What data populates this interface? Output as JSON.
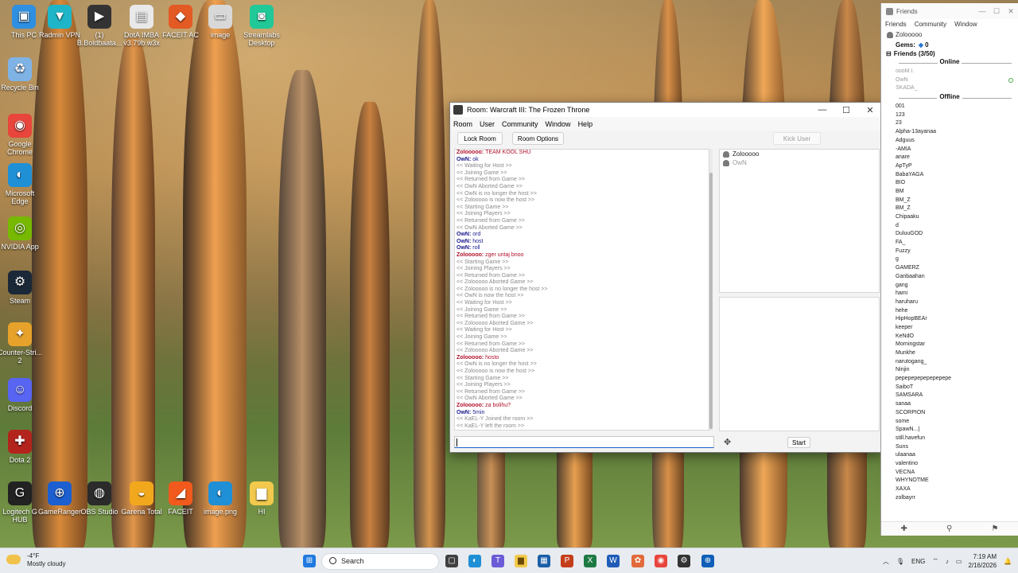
{
  "desktop": {
    "icons": [
      {
        "label": "This PC",
        "glyph": "▣",
        "color": "#2f8fe0"
      },
      {
        "label": "Radmin VPN",
        "glyph": "▼",
        "color": "#1fb5c8"
      },
      {
        "label": "(1) B.Boldbaata...",
        "glyph": "▶",
        "color": "#333333"
      },
      {
        "label": "DotA IMBA v3.79b.w3x",
        "glyph": "▤",
        "color": "#e9e9e9"
      },
      {
        "label": "FACEIT AC",
        "glyph": "◆",
        "color": "#e35a24"
      },
      {
        "label": "image",
        "glyph": "▭",
        "color": "#d8d8d8"
      },
      {
        "label": "Streamlabs Desktop",
        "glyph": "◙",
        "color": "#20c997"
      },
      {
        "label": "Recycle Bin",
        "glyph": "♻",
        "color": "#7fb3e6"
      },
      {
        "label": "Google Chrome",
        "glyph": "◉",
        "color": "#e8453c"
      },
      {
        "label": "Microsoft Edge",
        "glyph": "◐",
        "color": "#1f8fd6"
      },
      {
        "label": "NVIDIA App",
        "glyph": "◎",
        "color": "#76b900"
      },
      {
        "label": "Steam",
        "glyph": "⚙",
        "color": "#1b2838"
      },
      {
        "label": "Counter-Stri... 2",
        "glyph": "✦",
        "color": "#e7a22b"
      },
      {
        "label": "Discord",
        "glyph": "☺",
        "color": "#5865f2"
      },
      {
        "label": "Dota 2",
        "glyph": "✚",
        "color": "#b3241d"
      },
      {
        "label": "Logitech G HUB",
        "glyph": "G",
        "color": "#222222"
      },
      {
        "label": "GameRanger",
        "glyph": "⊕",
        "color": "#1b5fd1"
      },
      {
        "label": "OBS Studio",
        "glyph": "◍",
        "color": "#2b2b2b"
      },
      {
        "label": "Garena Total",
        "glyph": "◒",
        "color": "#f2a81d"
      },
      {
        "label": "FACEIT",
        "glyph": "◢",
        "color": "#f25a1d"
      },
      {
        "label": "image.png",
        "glyph": "◐",
        "color": "#1f8fd6"
      },
      {
        "label": "HI",
        "glyph": "▆",
        "color": "#f2c94c"
      }
    ]
  },
  "room": {
    "title": "Room: Warcraft III: The Frozen Throne",
    "menu": [
      "Room",
      "User",
      "Community",
      "Window",
      "Help"
    ],
    "lock_label": "Lock Room",
    "options_label": "Room Options",
    "kick_label": "Kick User",
    "start_label": "Start",
    "users": [
      {
        "name": "Zolooooo",
        "kind": "me"
      },
      {
        "name": "OwN",
        "kind": "other"
      }
    ],
    "chat": [
      {
        "type": "me",
        "nick": "Zolooooo:",
        "text": "TEAM KOOL SHU"
      },
      {
        "type": "owner",
        "nick": "OwN:",
        "text": "ok"
      },
      {
        "type": "sys",
        "text": "<< Waiting for Host >>"
      },
      {
        "type": "sys",
        "text": "<< Joining Game >>"
      },
      {
        "type": "sys",
        "text": "<< Returned from Game >>"
      },
      {
        "type": "sys",
        "text": "<< OwN Aborted Game >>"
      },
      {
        "type": "sys",
        "text": "<< OwN is no longer the host >>"
      },
      {
        "type": "sys",
        "text": "<< Zolooooo is now the host >>"
      },
      {
        "type": "sys",
        "text": "<< Starting Game >>"
      },
      {
        "type": "sys",
        "text": "<< Joining Players >>"
      },
      {
        "type": "sys",
        "text": "<< Returned from Game >>"
      },
      {
        "type": "sys",
        "text": "<< OwN Aborted Game >>"
      },
      {
        "type": "owner",
        "nick": "OwN:",
        "text": "ord"
      },
      {
        "type": "owner",
        "nick": "OwN:",
        "text": "host"
      },
      {
        "type": "owner",
        "nick": "OwN:",
        "text": "roll"
      },
      {
        "type": "me",
        "nick": "Zolooooo:",
        "text": "zger untaj bnoo"
      },
      {
        "type": "sys",
        "text": "<< Starting Game >>"
      },
      {
        "type": "sys",
        "text": "<< Joining Players >>"
      },
      {
        "type": "sys",
        "text": "<< Returned from Game >>"
      },
      {
        "type": "sys",
        "text": "<< Zolooooo Aborted Game >>"
      },
      {
        "type": "sys",
        "text": "<< Zolooooo is no longer the host >>"
      },
      {
        "type": "sys",
        "text": "<< OwN is now the host >>"
      },
      {
        "type": "sys",
        "text": "<< Waiting for Host >>"
      },
      {
        "type": "sys",
        "text": "<< Joining Game >>"
      },
      {
        "type": "sys",
        "text": "<< Returned from Game >>"
      },
      {
        "type": "sys",
        "text": "<< Zolooooo Aborted Game >>"
      },
      {
        "type": "sys",
        "text": "<< Waiting for Host >>"
      },
      {
        "type": "sys",
        "text": "<< Joining Game >>"
      },
      {
        "type": "sys",
        "text": "<< Returned from Game >>"
      },
      {
        "type": "sys",
        "text": "<< Zolooooo Aborted Game >>"
      },
      {
        "type": "me",
        "nick": "Zolooooo:",
        "text": "hosto"
      },
      {
        "type": "sys",
        "text": "<< OwN is no longer the host >>"
      },
      {
        "type": "sys",
        "text": "<< Zolooooo is now the host >>"
      },
      {
        "type": "sys",
        "text": "<< Starting Game >>"
      },
      {
        "type": "sys",
        "text": "<< Joining Players >>"
      },
      {
        "type": "sys",
        "text": "<< Returned from Game >>"
      },
      {
        "type": "sys",
        "text": "<< OwN Aborted Game >>"
      },
      {
        "type": "me",
        "nick": "Zolooooo:",
        "text": "za bolihu?"
      },
      {
        "type": "owner",
        "nick": "OwN:",
        "text": "5min"
      },
      {
        "type": "sys",
        "text": "<< KaEL-Y Joined the room >>"
      },
      {
        "type": "sys",
        "text": "<< KaEL-Y left the room >>"
      }
    ]
  },
  "friends": {
    "title": "Friends",
    "menu": [
      "Friends",
      "Community",
      "Window"
    ],
    "me": "Zolooooo",
    "gems_label": "Gems:",
    "gems_value": "0",
    "group_label": "Friends (3/50)",
    "online_label": "Online",
    "offline_label": "Offline",
    "online": [
      "oooM.I.",
      "OwN",
      "SKADA_"
    ],
    "offline": [
      "001",
      "123",
      "23",
      "Alpha-13ayanaa",
      "Adguus",
      "-AMIA",
      "anare",
      "ApTyP",
      "BabaYAGA",
      "BIO",
      "BM",
      "BM_Z",
      "BM_Z",
      "Chipaaku",
      "d",
      "DuluuGOD",
      "FA_",
      "Fuzzy",
      "g",
      "GAMERZ",
      "Ganbaahan",
      "gang",
      "hami",
      "haruharu",
      "hehe",
      "HipHopBEAr",
      "keeper",
      "KeNdO",
      "Morningstar",
      "Munkhe",
      "narutogang_",
      "Ninjin",
      "pepepepepepepepepe",
      "SaiboT",
      "SAMSARA",
      "sanaa",
      "SCORPION",
      "some",
      "SpawN...|",
      "still.havefun",
      "Suns",
      "ulaanaa",
      "valentino",
      "VECNA",
      "WHYNOTME",
      "XAXA",
      "zolbayrr"
    ]
  },
  "taskbar": {
    "weather_temp": "-4°F",
    "weather_desc": "Mostly cloudy",
    "search_placeholder": "Search",
    "lang": "ENG",
    "time": "7:19 AM",
    "date": "2/16/2026"
  }
}
